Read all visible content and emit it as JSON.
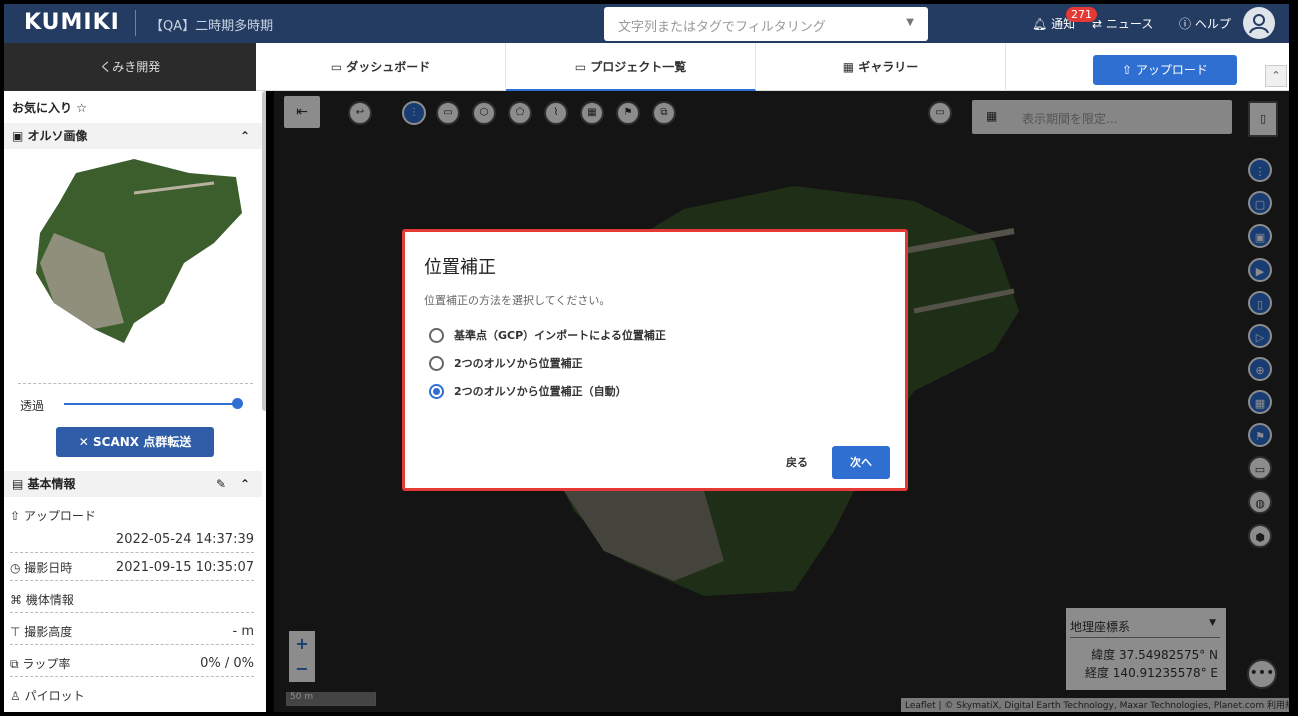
{
  "header": {
    "logo": "KUMIKI",
    "project_name": "【QA】二時期多時期",
    "filter_placeholder": "文字列またはタグでフィルタリング",
    "notification_label": "通知",
    "notification_count": "271",
    "news_label": "ニュース",
    "help_label": "ヘルプ"
  },
  "navbar": {
    "workspace": "くみき開発",
    "tabs": [
      {
        "label": "ダッシュボード"
      },
      {
        "label": "プロジェクト一覧"
      },
      {
        "label": "ギャラリー"
      }
    ],
    "upload_label": "アップロード"
  },
  "sidebar": {
    "favorite_label": "お気に入り",
    "ortho_header": "オルソ画像",
    "opacity_label": "透過",
    "opacity_value": 1.0,
    "scanx_label": "SCANX 点群転送",
    "basic_info_header": "基本情報",
    "upload_label": "アップロード",
    "upload_date": "2022-05-24 14:37:39",
    "shot_label": "撮影日時",
    "shot_date": "2021-09-15 10:35:07",
    "device_label": "機体情報",
    "altitude_label": "撮影高度",
    "altitude_value": "- m",
    "overlap_label": "ラップ率",
    "overlap_value": "0% / 0%",
    "pilot_label": "パイロット"
  },
  "map": {
    "date_placeholder": "表示期間を限定...",
    "coord_system": "地理座標系",
    "lat_label": "緯度",
    "lat_value": "37.54982575° N",
    "lng_label": "経度",
    "lng_value": "140.91235578° E",
    "scale_label": "50 m",
    "attribution": "Leaflet | © SkymatiX, Digital Earth Technology, Maxar Technologies, Planet.com 利用規約"
  },
  "modal": {
    "title": "位置補正",
    "description": "位置補正の方法を選択してください。",
    "options": [
      {
        "label": "基準点（GCP）インポートによる位置補正",
        "selected": false
      },
      {
        "label": "2つのオルソから位置補正",
        "selected": false
      },
      {
        "label": "2つのオルソから位置補正（自動）",
        "selected": true
      }
    ],
    "back_label": "戻る",
    "next_label": "次へ"
  },
  "colors": {
    "primary": "#2f6fd1",
    "header_bg": "#243b62",
    "highlight": "#e53935"
  }
}
